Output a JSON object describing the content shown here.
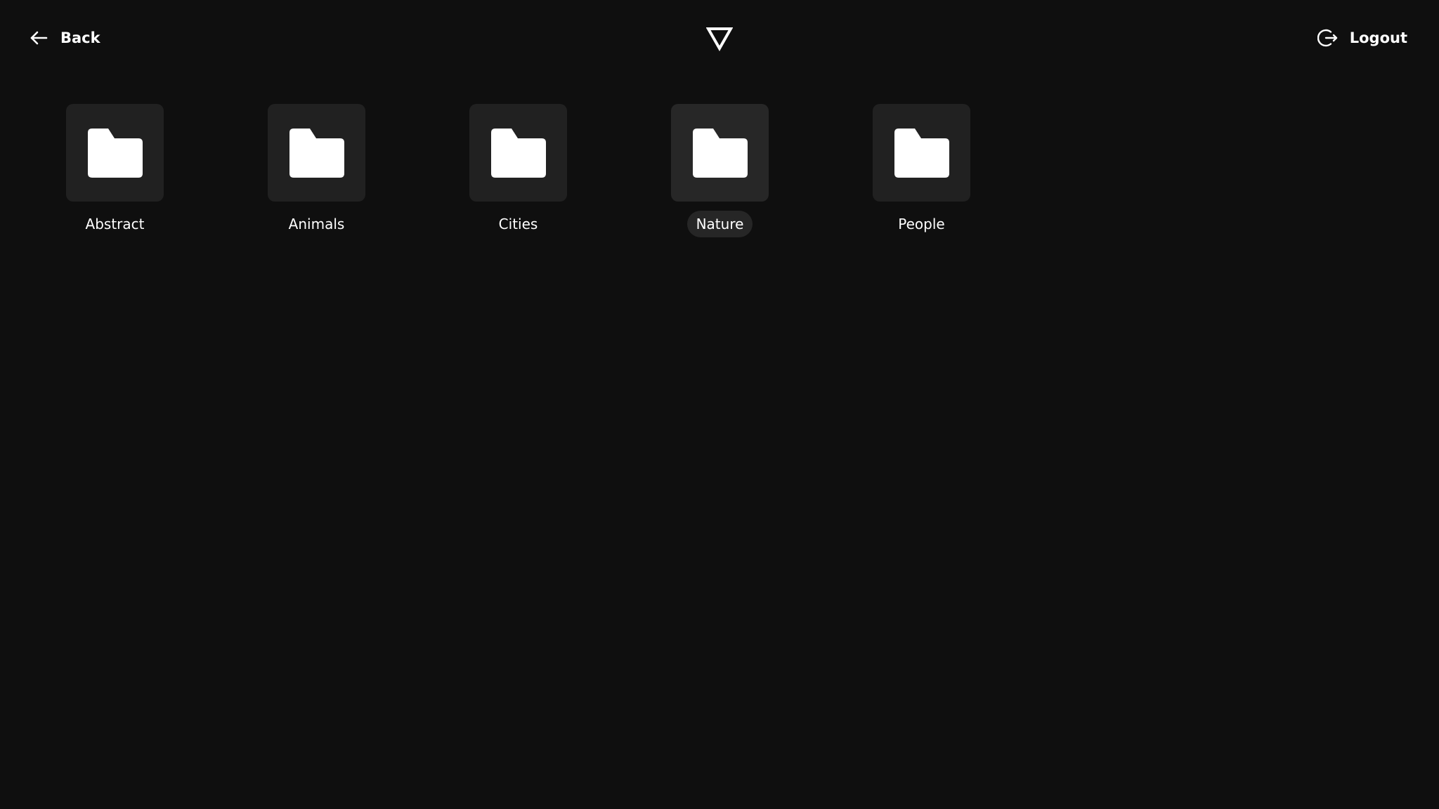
{
  "header": {
    "back_label": "Back",
    "logout_label": "Logout",
    "back_icon": "arrow-left-icon",
    "logout_icon": "logout-icon",
    "logo_icon": "triangle-logo-icon"
  },
  "folders": [
    {
      "name": "Abstract",
      "selected": false
    },
    {
      "name": "Animals",
      "selected": false
    },
    {
      "name": "Cities",
      "selected": false
    },
    {
      "name": "Nature",
      "selected": true
    },
    {
      "name": "People",
      "selected": false
    }
  ],
  "colors": {
    "background": "#0f0f0f",
    "tile": "#212121",
    "selected_label_bg": "#262626",
    "text": "#ffffff"
  }
}
